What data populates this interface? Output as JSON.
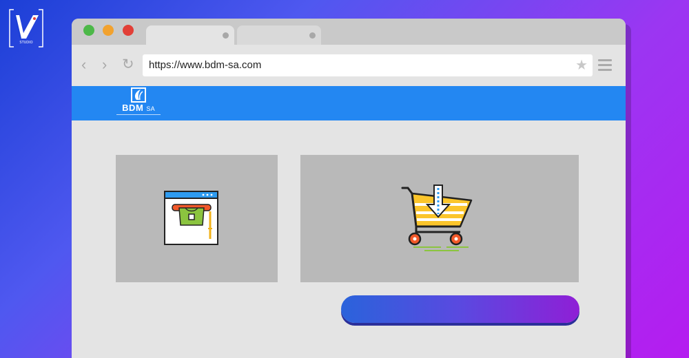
{
  "overlay": {
    "studio_logo": "studio-logo-icon"
  },
  "browser": {
    "tabs": [
      {
        "label": ""
      },
      {
        "label": ""
      }
    ],
    "toolbar": {
      "back_icon": "‹",
      "forward_icon": "›",
      "reload_icon": "↻",
      "url": "https://www.bdm-sa.com",
      "bookmark_icon": "★"
    }
  },
  "site": {
    "logo_text": "BDM",
    "logo_suffix": "SA",
    "cards": [
      {
        "icon": "payment-terminal-icon"
      },
      {
        "icon": "shopping-cart-download-icon"
      }
    ],
    "cta_label": ""
  },
  "colors": {
    "header": "#2387f2",
    "card": "#b9b9b9",
    "cta_start": "#2a63db",
    "cta_end": "#8f1fd6"
  }
}
